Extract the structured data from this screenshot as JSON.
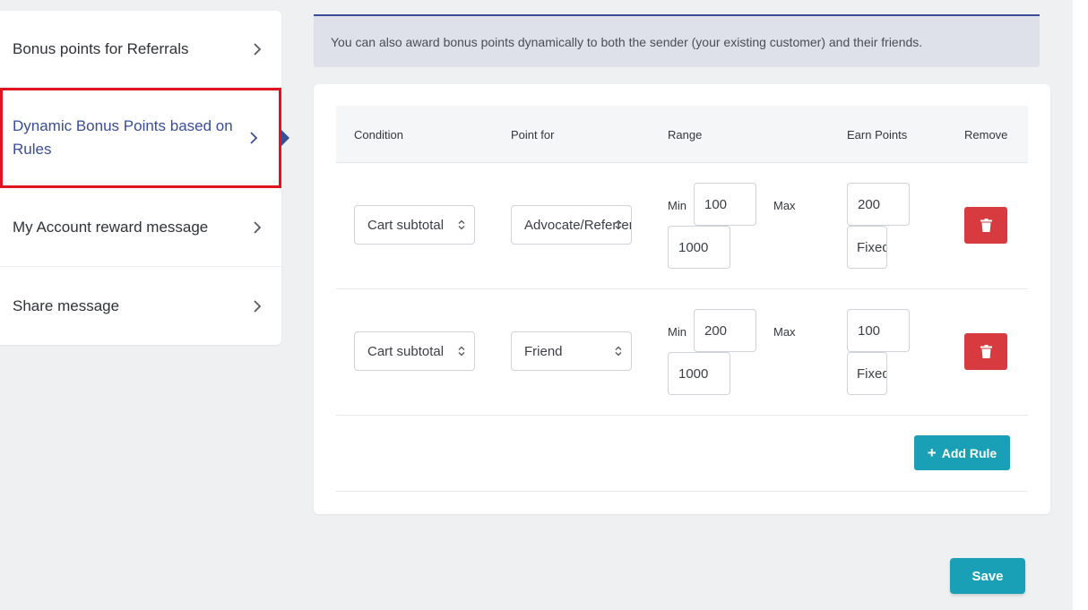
{
  "sidebar": {
    "items": [
      {
        "label": "Bonus points for Referrals"
      },
      {
        "label": "Dynamic Bonus Points based on Rules"
      },
      {
        "label": "My Account reward message"
      },
      {
        "label": "Share message"
      }
    ]
  },
  "banner": {
    "text": "You can also award bonus points dynamically to both the sender (your existing customer) and their friends."
  },
  "table": {
    "headers": {
      "condition": "Condition",
      "point_for": "Point for",
      "range": "Range",
      "earn_points": "Earn Points",
      "remove": "Remove"
    },
    "min_label": "Min",
    "max_label": "Max",
    "rows": [
      {
        "condition": "Cart subtotal",
        "point_for": "Advocate/Referrer",
        "min": "100",
        "max": "1000",
        "earn_points": "200",
        "earn_type": "Fixed"
      },
      {
        "condition": "Cart subtotal",
        "point_for": "Friend",
        "min": "200",
        "max": "1000",
        "earn_points": "100",
        "earn_type": "Fixed"
      }
    ]
  },
  "add_rule_label": "Add Rule",
  "save_label": "Save",
  "colors": {
    "accent": "#19a0b7",
    "active_nav": "#3a4d98",
    "danger": "#d73a3f",
    "highlight_border": "#e0131f"
  }
}
